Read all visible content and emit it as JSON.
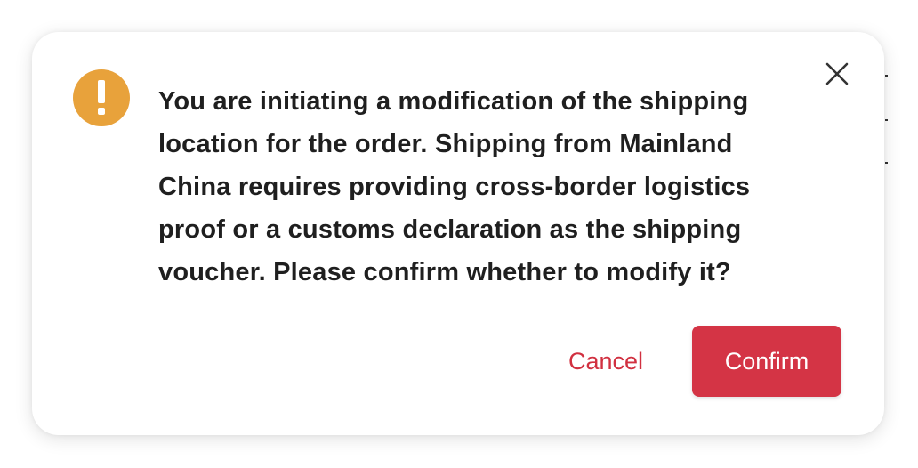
{
  "dialog": {
    "message": "You are initiating a modification of the shipping location for the order. Shipping from Mainland China requires providing cross-border logistics proof or a customs declaration as the shipping voucher. Please confirm whether to modify it?",
    "icon": "warning-icon",
    "close_icon": "close-icon",
    "cancel_label": "Cancel",
    "confirm_label": "Confirm"
  },
  "colors": {
    "warning": "#e8a23b",
    "accent": "#d43445",
    "text": "#1f1f1f"
  }
}
